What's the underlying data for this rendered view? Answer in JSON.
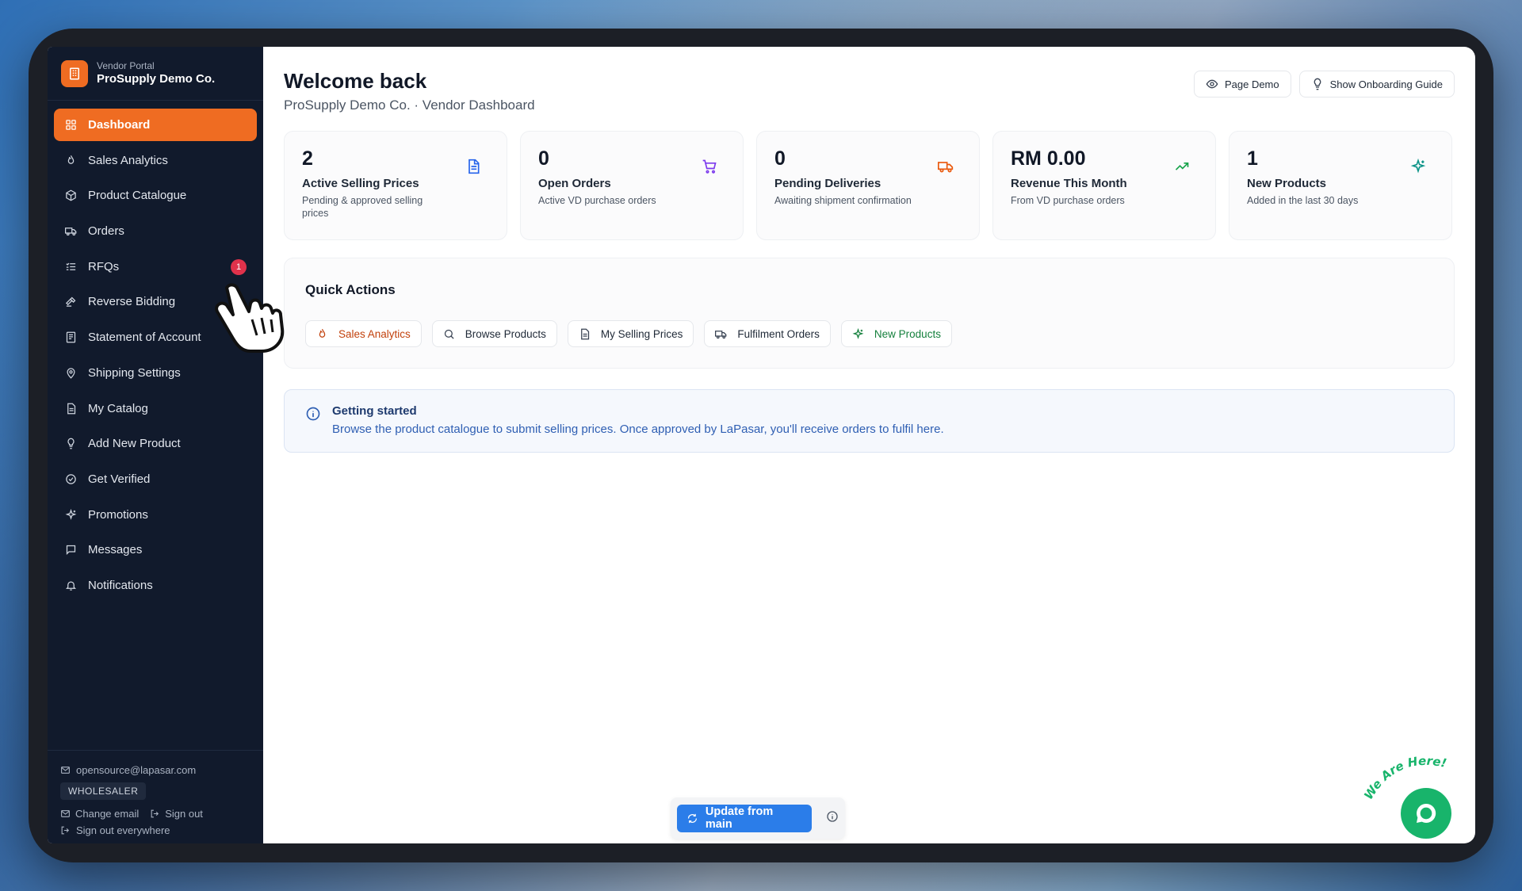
{
  "sidebar": {
    "brand_sub": "Vendor Portal",
    "brand_name": "ProSupply Demo Co.",
    "items": [
      {
        "label": "Dashboard",
        "icon": "grid-icon",
        "active": true
      },
      {
        "label": "Sales Analytics",
        "icon": "flame-icon"
      },
      {
        "label": "Product Catalogue",
        "icon": "package-icon"
      },
      {
        "label": "Orders",
        "icon": "truck-icon"
      },
      {
        "label": "RFQs",
        "icon": "list-check-icon",
        "badge": "1"
      },
      {
        "label": "Reverse Bidding",
        "icon": "gavel-icon"
      },
      {
        "label": "Statement of Account",
        "icon": "ledger-icon"
      },
      {
        "label": "Shipping Settings",
        "icon": "map-pin-icon"
      },
      {
        "label": "My Catalog",
        "icon": "file-icon"
      },
      {
        "label": "Add New Product",
        "icon": "lightbulb-icon"
      },
      {
        "label": "Get Verified",
        "icon": "check-circle-icon"
      },
      {
        "label": "Promotions",
        "icon": "sparkles-icon"
      },
      {
        "label": "Messages",
        "icon": "message-icon"
      },
      {
        "label": "Notifications",
        "icon": "bell-icon"
      }
    ],
    "footer": {
      "email": "opensource@lapasar.com",
      "role": "WHOLESALER",
      "change_email": "Change email",
      "sign_out": "Sign out",
      "sign_out_everywhere": "Sign out everywhere"
    }
  },
  "header": {
    "title": "Welcome back",
    "subtitle": "ProSupply Demo Co. · Vendor Dashboard",
    "page_demo": "Page Demo",
    "onboarding": "Show Onboarding Guide"
  },
  "stats": [
    {
      "value": "2",
      "label": "Active Selling Prices",
      "desc": "Pending & approved selling prices",
      "icon": "document-icon",
      "color": "#2563eb"
    },
    {
      "value": "0",
      "label": "Open Orders",
      "desc": "Active VD purchase orders",
      "icon": "cart-icon",
      "color": "#7c3aed"
    },
    {
      "value": "0",
      "label": "Pending Deliveries",
      "desc": "Awaiting shipment confirmation",
      "icon": "truck-icon",
      "color": "#ea580c"
    },
    {
      "value": "RM 0.00",
      "label": "Revenue This Month",
      "desc": "From VD purchase orders",
      "icon": "trending-up-icon",
      "color": "#16a34a"
    },
    {
      "value": "1",
      "label": "New Products",
      "desc": "Added in the last 30 days",
      "icon": "sparkles-icon",
      "color": "#0d9488"
    }
  ],
  "quick_actions": {
    "title": "Quick Actions",
    "buttons": [
      {
        "label": "Sales Analytics",
        "icon": "flame-icon"
      },
      {
        "label": "Browse Products",
        "icon": "search-icon"
      },
      {
        "label": "My Selling Prices",
        "icon": "document-icon"
      },
      {
        "label": "Fulfilment Orders",
        "icon": "truck-icon"
      },
      {
        "label": "New Products",
        "icon": "sparkles-icon"
      }
    ]
  },
  "info": {
    "title": "Getting started",
    "text": "Browse the product catalogue to submit selling prices. Once approved by LaPasar, you'll receive orders to fulfil here."
  },
  "bottom_bar": {
    "update_label": "Update from main"
  },
  "chat": {
    "tagline": "We Are Here!"
  },
  "colors": {
    "accent": "#ef6c22",
    "sidebar_bg": "#111a2c",
    "badge": "#e0324b",
    "primary_blue": "#2b7de9",
    "chat_green": "#18b46b"
  }
}
